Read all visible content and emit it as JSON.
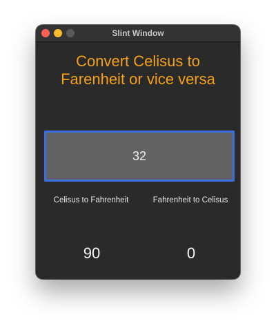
{
  "window": {
    "title": "Slint Window"
  },
  "heading": {
    "line1": "Convert Celisus to",
    "line2": "Farenheit or vice versa"
  },
  "input": {
    "value": "32"
  },
  "labels": {
    "c_to_f": "Celisus to Fahrenheit",
    "f_to_c": "Fahrenheit to Celisus"
  },
  "results": {
    "c_to_f": "90",
    "f_to_c": "0"
  },
  "colors": {
    "accent_heading": "#f5a01a",
    "input_border": "#3a6fe0",
    "input_bg": "#636363",
    "window_bg": "#2a2a2a"
  }
}
